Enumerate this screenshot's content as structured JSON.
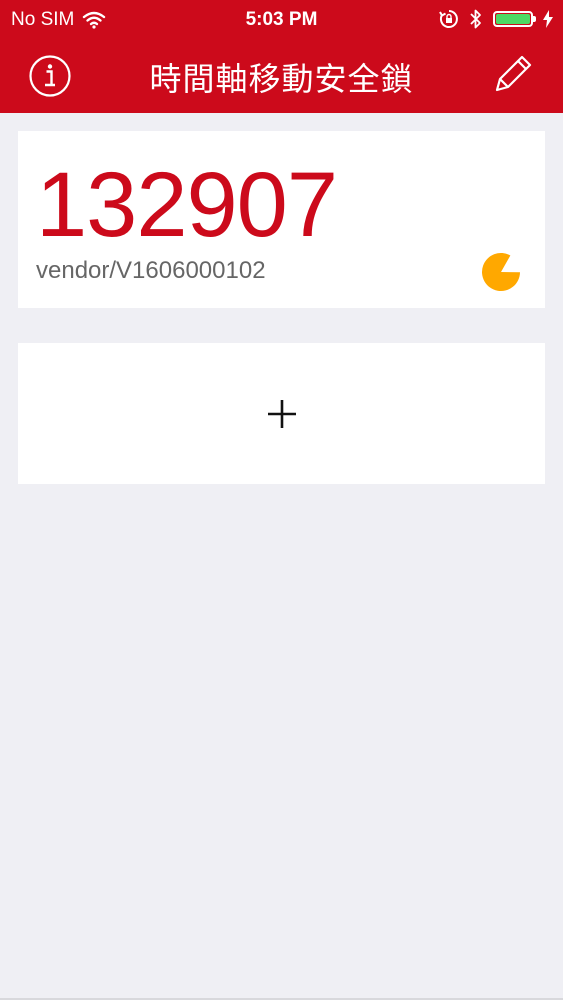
{
  "status_bar": {
    "carrier": "No SIM",
    "time": "5:03 PM"
  },
  "nav": {
    "title": "時間軸移動安全鎖"
  },
  "token": {
    "code": "132907",
    "account": "vendor/V1606000102",
    "time_remaining_fraction": 0.83
  },
  "colors": {
    "brand_red": "#cc0a1b",
    "background": "#efeff4",
    "timer_orange": "#ffa800",
    "battery_green": "#4cd964"
  },
  "icons": {
    "info": "info-circle-icon",
    "edit": "pencil-icon",
    "add": "plus-icon",
    "timer": "pie-timer-icon"
  }
}
